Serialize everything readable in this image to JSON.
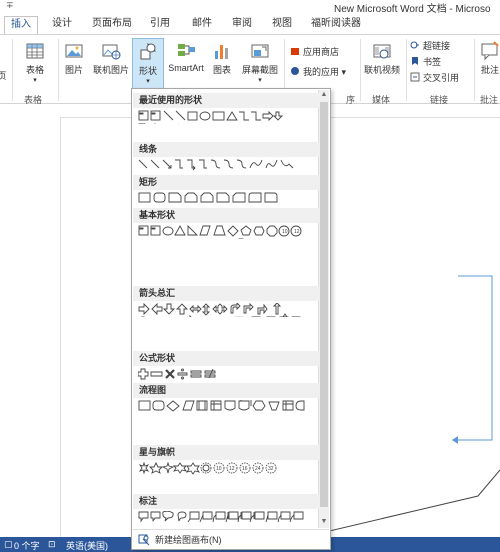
{
  "window": {
    "title": "New Microsoft Word 文档 - Microso",
    "quick_access": "∓"
  },
  "tabs": [
    {
      "label": "插入",
      "active": true
    },
    {
      "label": "设计"
    },
    {
      "label": "页面布局"
    },
    {
      "label": "引用"
    },
    {
      "label": "邮件"
    },
    {
      "label": "审阅"
    },
    {
      "label": "视图"
    },
    {
      "label": "福昕阅读器"
    }
  ],
  "ribbon": {
    "page_partial": "页",
    "table": "表格",
    "picture": "图片",
    "online_picture": "联机图片",
    "shapes": "形状",
    "smartart": "SmartArt",
    "chart": "图表",
    "screenshot": "屏幕截图",
    "app_store": "应用商店",
    "my_apps": "我的应用",
    "online_video": "联机视频",
    "hyperlink": "超链接",
    "bookmark": "书签",
    "cross_ref": "交叉引用",
    "comment": "批注",
    "group_table": "表格",
    "group_apps_partial": "序",
    "group_media": "媒体",
    "group_links": "链接",
    "group_comments": "批注"
  },
  "dropdown": {
    "sections": [
      "最近使用的形状",
      "线条",
      "矩形",
      "基本形状",
      "箭头总汇",
      "公式形状",
      "流程图",
      "星与旗帜",
      "标注"
    ],
    "footer": "新建绘图画布(N)"
  },
  "status": {
    "words": "0 个字",
    "language": "英语(美国)"
  },
  "colors": {
    "accent": "#2b579a",
    "shapes_button_bg": "#cde6f7",
    "section_bg": "#f0f0f0",
    "connector_blue": "#5b9bd5"
  }
}
